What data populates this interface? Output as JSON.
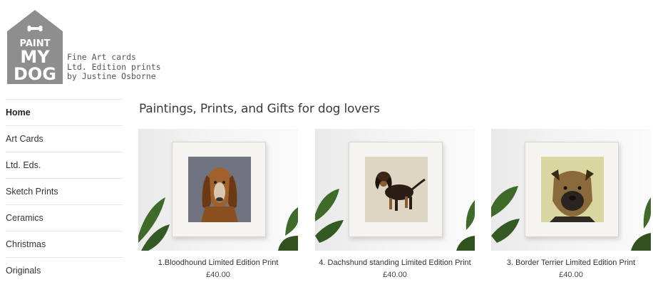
{
  "logo": {
    "line1": "PAINT",
    "line2": "MY",
    "line3": "DOG"
  },
  "tagline": [
    "Fine Art cards",
    "Ltd. Edition prints",
    "by Justine Osborne"
  ],
  "nav": [
    {
      "label": "Home",
      "active": true
    },
    {
      "label": "Art Cards"
    },
    {
      "label": "Ltd. Eds."
    },
    {
      "label": "Sketch Prints"
    },
    {
      "label": "Ceramics"
    },
    {
      "label": "Christmas"
    },
    {
      "label": "Originals"
    }
  ],
  "page_title": "Paintings, Prints, and Gifts for dog lovers",
  "products": [
    {
      "name": "1.Bloodhound Limited Edition Print",
      "price": "£40.00",
      "art_bg": "#6f7480",
      "dog": "bloodhound"
    },
    {
      "name": "4. Dachshund standing Limited Edition Print",
      "price": "£40.00",
      "art_bg": "#ddd6c2",
      "dog": "dachshund"
    },
    {
      "name": "3. Border Terrier Limited Edition Print",
      "price": "£40.00",
      "art_bg": "#d9d6a0",
      "dog": "border-terrier"
    }
  ],
  "colors": {
    "logo_gray": "#8e8e8e",
    "leaf_green": "#3f6b2a"
  }
}
